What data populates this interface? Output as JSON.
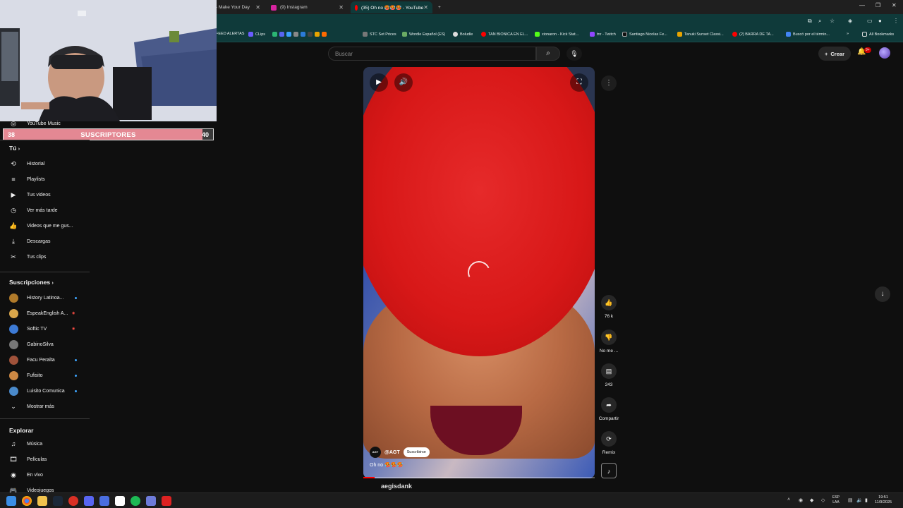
{
  "browser": {
    "tabs": [
      {
        "label": "- Make Your Day",
        "active": false
      },
      {
        "label": "(9) Instagram",
        "active": false
      },
      {
        "label": "(35) Oh no 🥵🥵🥵 - YouTube",
        "active": true
      }
    ],
    "new_tab": "+",
    "bookmarks": [
      "FEED ALERTAS",
      "CLips",
      "STC Set Prices",
      "Wordle Español (ES)",
      "Boludle",
      "TAN BIONICA EN EL...",
      "xionaron - Kick Stat...",
      "tnr - Twitch",
      "Santiago Nicolas Fe...",
      "Tanuki Sunset Classi...",
      "(2) BARRA DE TA...",
      "Buscó por el términ...",
      "All Bookmarks"
    ]
  },
  "overlay": {
    "subs_left": "38",
    "subs_title": "SUSCRIPTORES",
    "subs_right": "40",
    "subs_progress": 0.95
  },
  "youtube": {
    "search_placeholder": "Buscar",
    "create_label": "Crear",
    "notification_count": "9+",
    "sidebar": {
      "music_item": "YouTube Music",
      "you_heading": "Tú",
      "you_items": [
        {
          "icon": "history-icon",
          "label": "Historial"
        },
        {
          "icon": "playlist-icon",
          "label": "Playlists"
        },
        {
          "icon": "video-icon",
          "label": "Tus videos"
        },
        {
          "icon": "clock-icon",
          "label": "Ver más tarde"
        },
        {
          "icon": "thumbs-up-icon",
          "label": "Videos que me gus..."
        },
        {
          "icon": "download-icon",
          "label": "Descargas"
        },
        {
          "icon": "scissors-icon",
          "label": "Tus clips"
        }
      ],
      "subs_heading": "Suscripciones",
      "subscriptions": [
        {
          "label": "History Latinoa...",
          "indicator": "dot"
        },
        {
          "label": "EspeakEnglish A...",
          "indicator": "live"
        },
        {
          "label": "Softic TV",
          "indicator": "live"
        },
        {
          "label": "GabinoSilva",
          "indicator": "none"
        },
        {
          "label": "Facu Peralta",
          "indicator": "dot"
        },
        {
          "label": "Fufisito",
          "indicator": "dot"
        },
        {
          "label": "Luisito Comunica",
          "indicator": "dot"
        }
      ],
      "show_more": "Mostrar más",
      "explore_heading": "Explorar",
      "explore_items": [
        {
          "icon": "music-icon",
          "label": "Música"
        },
        {
          "icon": "film-icon",
          "label": "Películas"
        },
        {
          "icon": "live-icon",
          "label": "En vivo"
        },
        {
          "icon": "gamepad-icon",
          "label": "Videojuegos"
        }
      ]
    },
    "short": {
      "channel_handle": "@AGT",
      "channel_logo_text": "AGT",
      "subscribe_label": "Suscribirse",
      "title": "Oh no 🥵🥵🥵",
      "progress": 0.05,
      "actions": [
        {
          "icon": "thumbs-up-icon",
          "label": "76 k"
        },
        {
          "icon": "thumbs-down-icon",
          "label": "No me ..."
        },
        {
          "icon": "comment-icon",
          "label": "243"
        },
        {
          "icon": "share-icon",
          "label": "Compartir"
        },
        {
          "icon": "remix-icon",
          "label": "Remix"
        }
      ],
      "next_channel": "aegisdank"
    }
  },
  "taskbar": {
    "lang_line1": "ESP",
    "lang_line2": "LAA",
    "time": "19:51",
    "date": "11/9/2025"
  }
}
